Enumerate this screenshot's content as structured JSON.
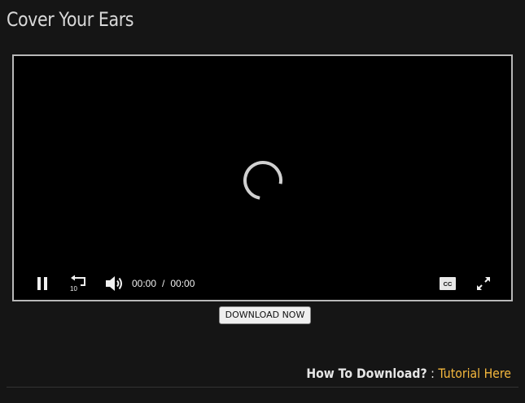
{
  "page": {
    "title": "Cover Your Ears"
  },
  "player": {
    "state": "loading",
    "current_time": "00:00",
    "time_separator": "/",
    "duration": "00:00",
    "rewind_seconds": "10",
    "cc_label": "CC",
    "icons": {
      "play_pause": "pause-icon",
      "rewind": "rewind-10-icon",
      "volume": "volume-icon",
      "captions": "cc-icon",
      "fullscreen": "fullscreen-icon",
      "spinner": "loading-spinner-icon"
    }
  },
  "download": {
    "button_label": "DOWNLOAD NOW",
    "how_to_label": "How To Download?",
    "colon": " : ",
    "tutorial_link": "Tutorial Here"
  },
  "colors": {
    "background": "#151515",
    "player_border": "#b8b8b8",
    "link_accent": "#f5b83d",
    "title_text": "#d8d8d8"
  }
}
